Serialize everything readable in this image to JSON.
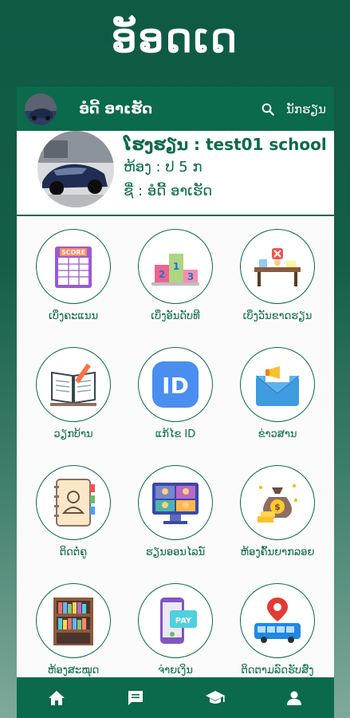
{
  "app": {
    "hero_title": "ອັອດເດ"
  },
  "appbar": {
    "user_name": "ອໍດີ້ ອາເຮັດ",
    "search_label": "ນັກຮຽນ"
  },
  "profile": {
    "school_line": "ໂຮງຮຽນ : test01 school",
    "class_line": "ຫ້ອງ : ປ 5 ກ",
    "name_line": "ຊື່ : ອໍດີ້ ອາເຮັດ"
  },
  "menu": [
    {
      "label": "ເບິ່ງຄະແນນ",
      "icon": "score-sheet-icon"
    },
    {
      "label": "ເບິ່ງອັນດັບທີ",
      "icon": "podium-ranking-icon"
    },
    {
      "label": "ເບິ່ງວັນຂາດຮຽນ",
      "icon": "absent-desk-icon"
    },
    {
      "label": "ວຽກບ້ານ",
      "icon": "homework-book-icon"
    },
    {
      "label": "ແກ້ໄຂ ID",
      "icon": "id-badge-icon"
    },
    {
      "label": "ຂ່າວສານ",
      "icon": "news-megaphone-icon"
    },
    {
      "label": "ຕິດຕໍ່ຄູ",
      "icon": "contact-book-icon"
    },
    {
      "label": "ຮຽນອອນໄລນ໌",
      "icon": "online-class-icon"
    },
    {
      "label": "ຫ້ອງຄົ້ນຍາກລອຍ",
      "icon": "money-bag-icon"
    },
    {
      "label": "ຫ້ອງສະໝຸດ",
      "icon": "bookshelf-icon"
    },
    {
      "label": "ຈ່າຍເງິນ",
      "icon": "payment-phone-icon"
    },
    {
      "label": "ຕິດຕາມລົດຮັບສົ່ງ",
      "icon": "bus-tracking-icon"
    }
  ],
  "bottom_nav": [
    "home-icon",
    "message-icon",
    "graduation-cap-icon",
    "profile-icon"
  ],
  "colors": {
    "primary": "#0b6a4c",
    "background_top": "#0e5a45"
  }
}
